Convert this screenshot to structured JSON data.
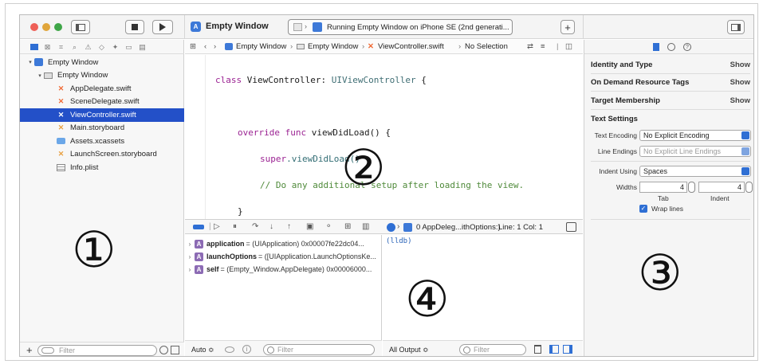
{
  "toolbar": {
    "project_title": "Empty Window",
    "status_text": "Running Empty Window on iPhone SE (2nd generati...",
    "add_label": "+"
  },
  "navigator": {
    "items": [
      {
        "label": "Empty Window",
        "type": "project",
        "disclosure": "▾"
      },
      {
        "label": "Empty Window",
        "type": "folder",
        "disclosure": "▾"
      },
      {
        "label": "AppDelegate.swift",
        "type": "swift"
      },
      {
        "label": "SceneDelegate.swift",
        "type": "swift"
      },
      {
        "label": "ViewController.swift",
        "type": "swift",
        "selected": true
      },
      {
        "label": "Main.storyboard",
        "type": "storyboard"
      },
      {
        "label": "Assets.xcassets",
        "type": "assets"
      },
      {
        "label": "LaunchScreen.storyboard",
        "type": "storyboard"
      },
      {
        "label": "Info.plist",
        "type": "plist"
      }
    ],
    "filter_placeholder": "Filter",
    "add_label": "+"
  },
  "jumpbar": {
    "crumb1": "Empty Window",
    "crumb2": "Empty Window",
    "crumb3": "ViewController.swift",
    "crumb4": "No Selection"
  },
  "code": {
    "line1_kw": "class",
    "line1_name": " ViewController: ",
    "line1_super": "UIViewController",
    "line1_end": " {",
    "line2_kw": "override func",
    "line2_rest": " viewDidLoad() {",
    "line3_kw": "super",
    "line3_rest": ".viewDidLoad()",
    "line4_comment": "// Do any additional setup after loading the view.",
    "line5": "}",
    "line6": "}"
  },
  "debugbar": {
    "frame_label": "0 AppDeleg...ithOptions:)",
    "position": "Line: 1  Col: 1"
  },
  "variables": [
    {
      "name": "application",
      "value": "= (UIApplication) 0x00007fe22dc04..."
    },
    {
      "name": "launchOptions",
      "value": "= ([UIApplication.LaunchOptionsKe..."
    },
    {
      "name": "self",
      "value": "= (Empty_Window.AppDelegate) 0x00006000..."
    }
  ],
  "variables_footer": {
    "scope": "Auto ≎",
    "filter_placeholder": "Filter"
  },
  "console": {
    "prompt": "(lldb)",
    "output_select": "All Output ≎",
    "filter_placeholder": "Filter"
  },
  "inspector": {
    "identity": "Identity and Type",
    "odr": "On Demand Resource Tags",
    "target": "Target Membership",
    "show": "Show",
    "text_settings": "Text Settings",
    "text_encoding_label": "Text Encoding",
    "text_encoding_value": "No Explicit Encoding",
    "line_endings_label": "Line Endings",
    "line_endings_value": "No Explicit Line Endings",
    "indent_using_label": "Indent Using",
    "indent_using_value": "Spaces",
    "widths_label": "Widths",
    "tab_width": "4",
    "indent_width": "4",
    "tab_label": "Tab",
    "indent_label": "Indent",
    "wrap_lines": "Wrap lines"
  },
  "markers": {
    "m1": "①",
    "m2": "②",
    "m3": "③",
    "m4": "④"
  },
  "colors": {
    "selection": "#2350c8",
    "accent": "#2f6fd4",
    "keyword": "#9b2393",
    "comment": "#4f8a3a"
  }
}
